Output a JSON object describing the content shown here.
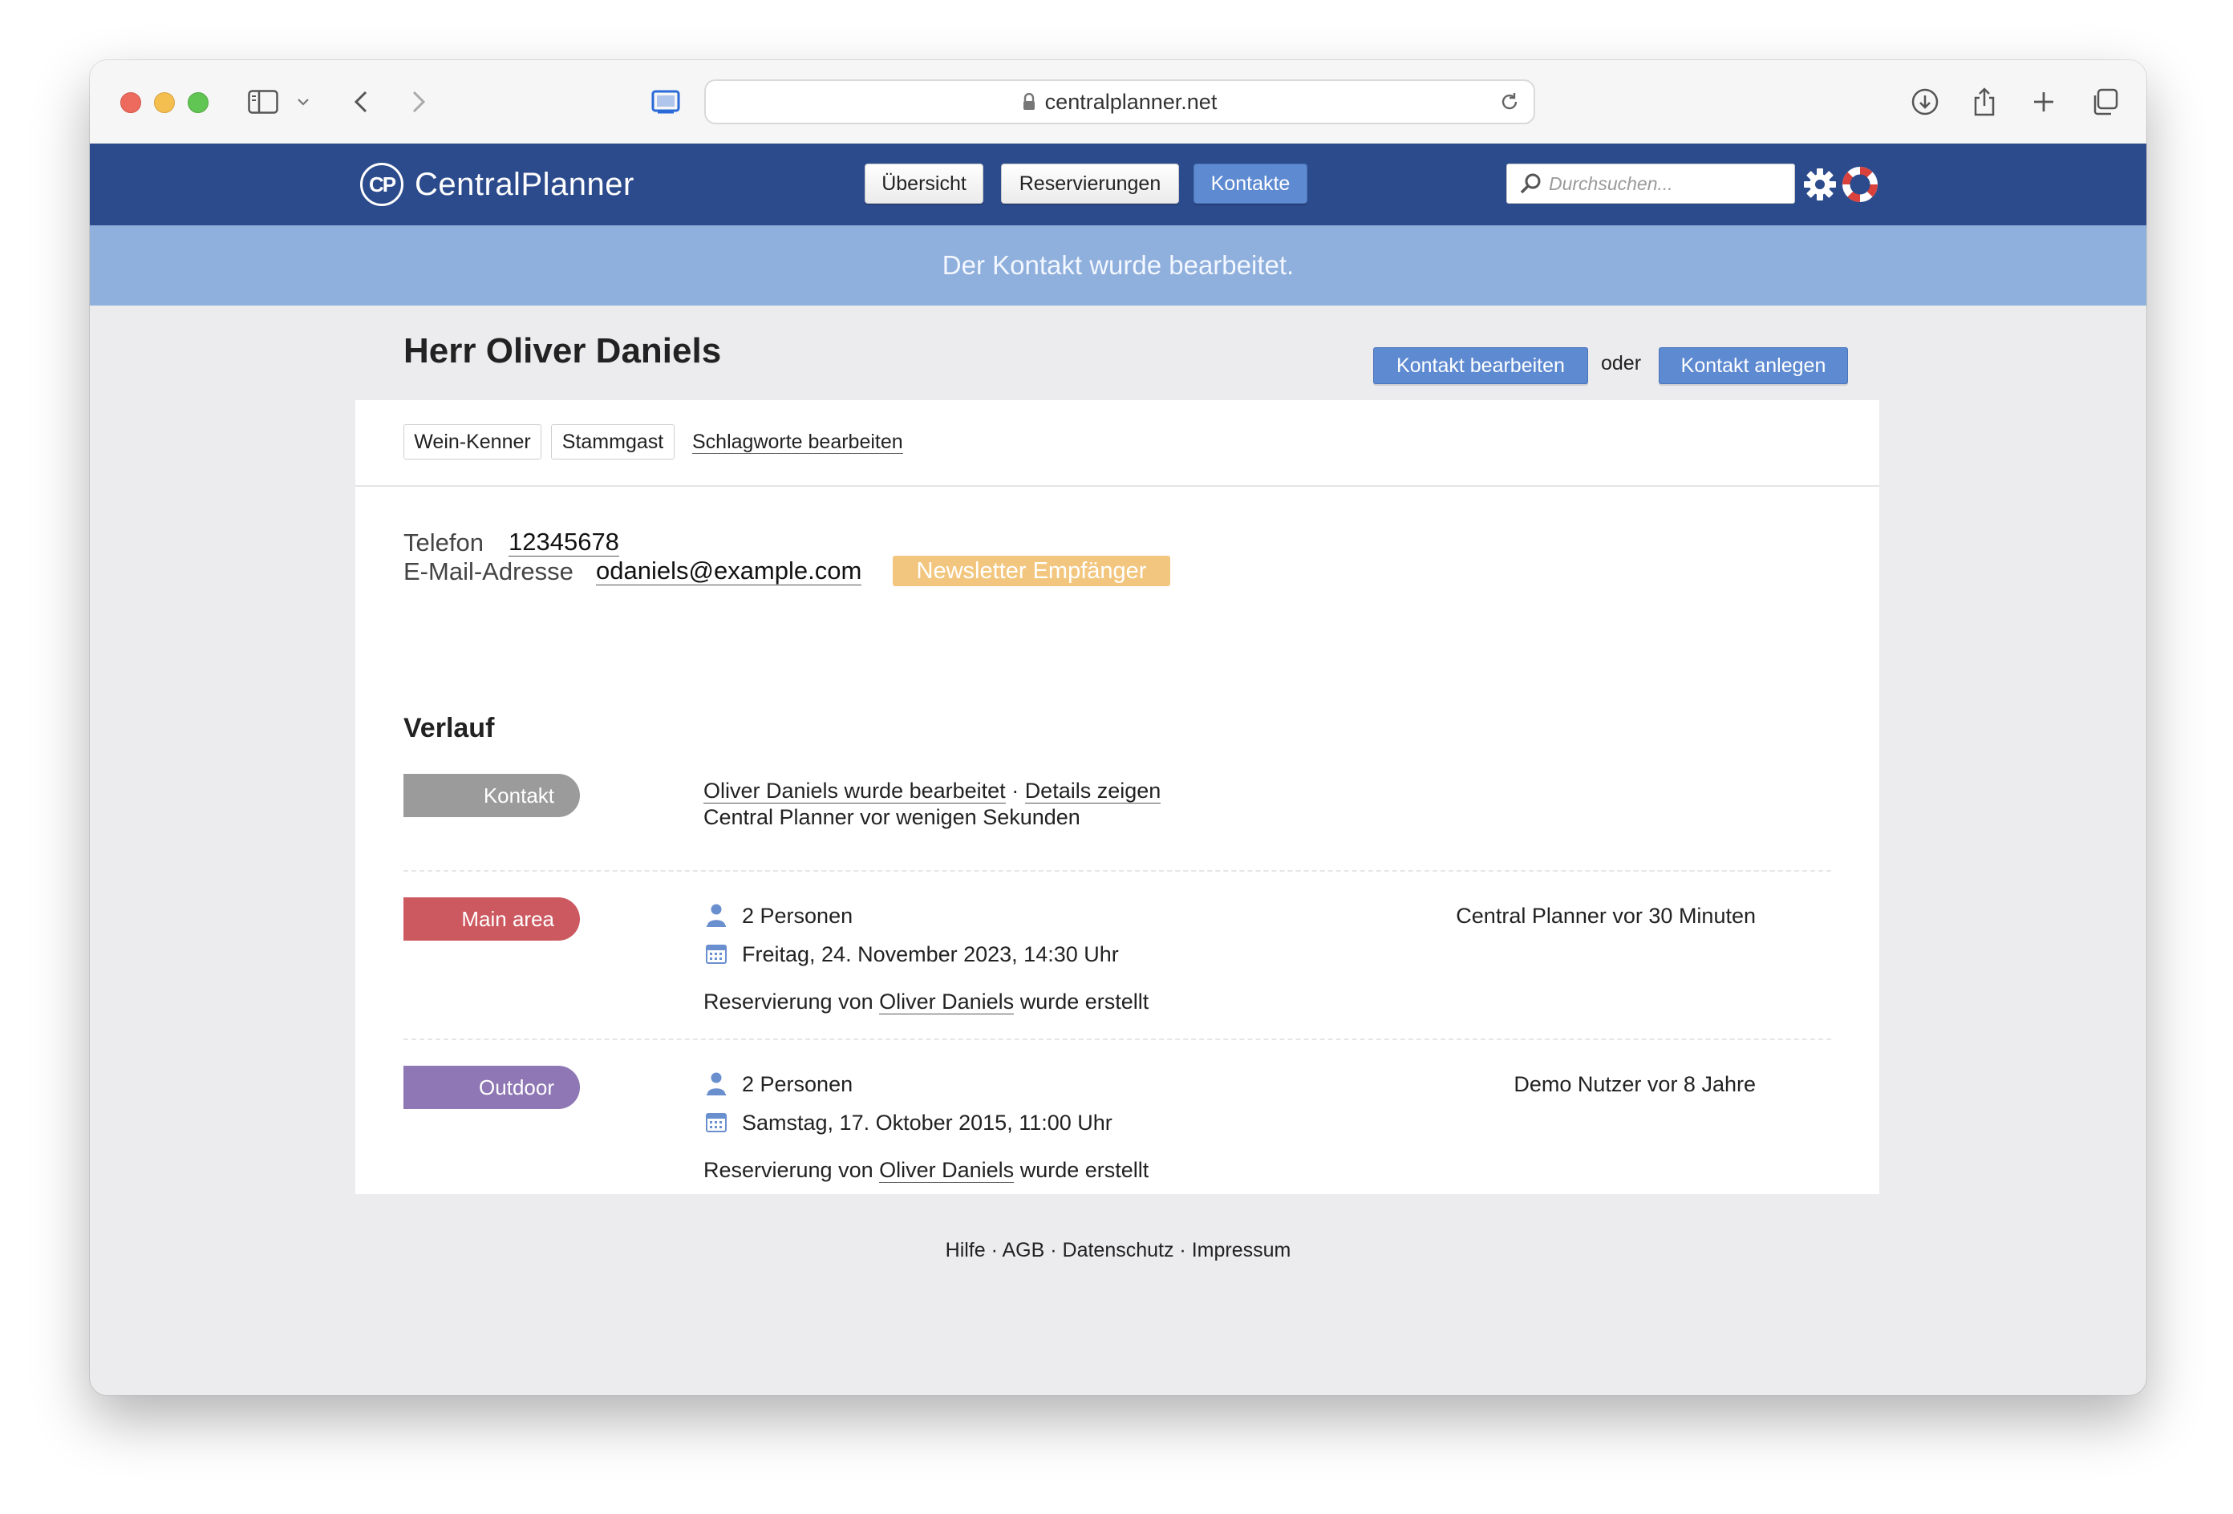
{
  "browser": {
    "url": "centralplanner.net"
  },
  "app": {
    "logo_mark": "CP",
    "logo_text": "CentralPlanner",
    "nav": [
      {
        "label": "Übersicht",
        "active": false
      },
      {
        "label": "Reservierungen",
        "active": false
      },
      {
        "label": "Kontakte",
        "active": true
      }
    ],
    "search_placeholder": "Durchsuchen..."
  },
  "flash": "Der Kontakt wurde bearbeitet.",
  "contact": {
    "title": "Herr Oliver Daniels",
    "edit_button": "Kontakt bearbeiten",
    "or_text": "oder",
    "new_button": "Kontakt anlegen",
    "tags": [
      "Wein-Kenner",
      "Stammgast"
    ],
    "edit_tags_link": "Schlagworte bearbeiten",
    "phone_label": "Telefon",
    "phone_value": "12345678",
    "email_label": "E-Mail-Adresse",
    "email_value": "odaniels@example.com",
    "newsletter_badge": "Newsletter Empfänger"
  },
  "history": {
    "title": "Verlauf",
    "entries": [
      {
        "category": "Kontakt",
        "color": "#9b9b9b",
        "line1_link": "Oliver Daniels wurde bearbeitet",
        "line1_sep": " · ",
        "line1_details": "Details zeigen",
        "line2": "Central Planner vor wenigen Sekunden"
      },
      {
        "category": "Main area",
        "color": "#cd5960",
        "persons": "2 Personen",
        "date": "Freitag, 24. November 2023, 14:30 Uhr",
        "desc_prefix": "Reservierung von ",
        "desc_name": "Oliver Daniels",
        "desc_suffix": " wurde erstellt",
        "meta": "Central Planner vor 30 Minuten"
      },
      {
        "category": "Outdoor",
        "color": "#8e77b4",
        "persons": "2 Personen",
        "date": "Samstag, 17. Oktober 2015, 11:00 Uhr",
        "desc_prefix": "Reservierung von ",
        "desc_name": "Oliver Daniels",
        "desc_suffix": " wurde erstellt",
        "meta": "Demo Nutzer vor 8 Jahre"
      }
    ]
  },
  "footer": {
    "links": [
      "Hilfe",
      "AGB",
      "Datenschutz",
      "Impressum"
    ],
    "separator": " · "
  },
  "icons": {
    "logo": "cp-logo-icon",
    "search": "magnifier-icon",
    "settings": "gear-icon",
    "help": "lifebuoy-icon",
    "person": "person-icon",
    "calendar": "calendar-icon"
  }
}
